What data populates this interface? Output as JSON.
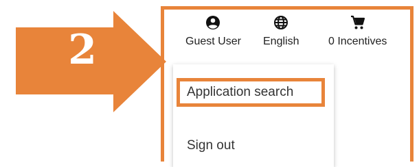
{
  "step": {
    "number": "2",
    "color": "#E8843A"
  },
  "header": {
    "user": {
      "label": "Guest User",
      "icon": "account-circle-icon"
    },
    "language": {
      "label": "English",
      "icon": "globe-icon"
    },
    "cart": {
      "label": "0 Incentives",
      "icon": "shopping-cart-icon"
    }
  },
  "menu": {
    "items": [
      {
        "label": "Application search",
        "highlighted": true
      },
      {
        "label": "Sign out",
        "highlighted": false
      }
    ]
  }
}
